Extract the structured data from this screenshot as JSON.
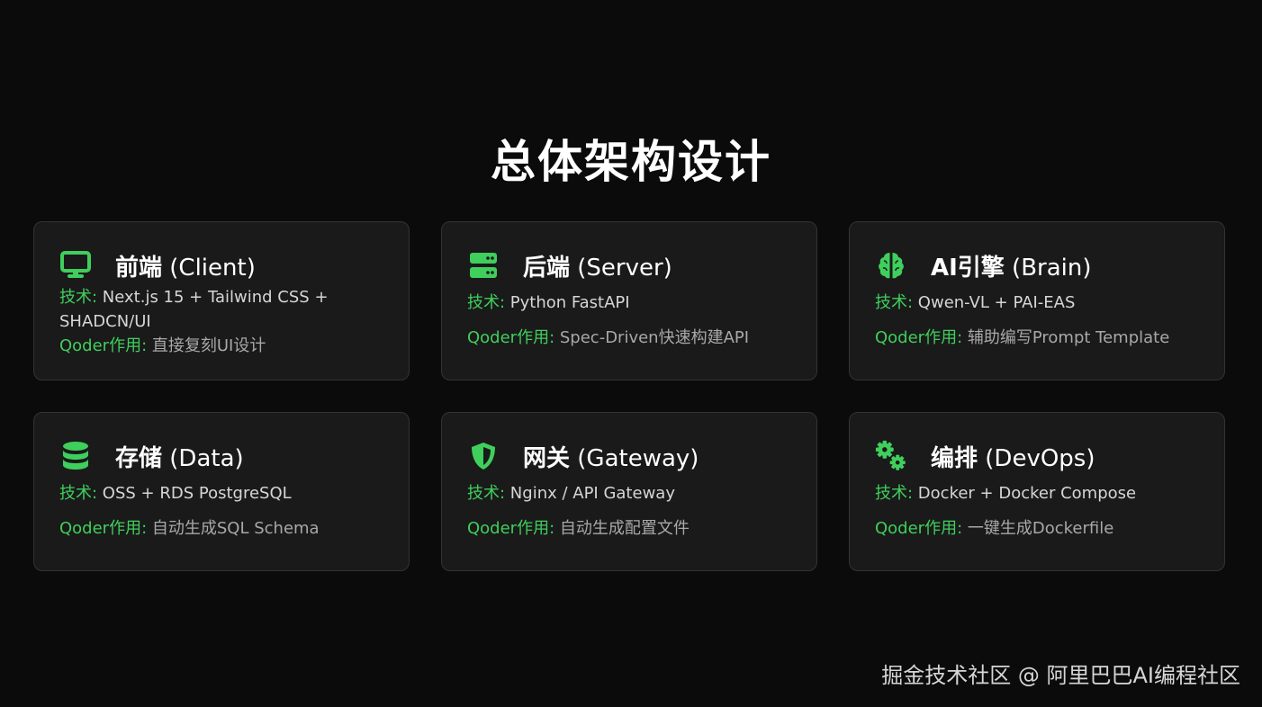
{
  "page": {
    "title": "总体架构设计",
    "footer": "掘金技术社区 @ 阿里巴巴AI编程社区"
  },
  "colors": {
    "background": "#0b0b0b",
    "card_bg": "#1a1a1a",
    "card_border": "#333333",
    "accent_green": "#3fcf5c",
    "text_primary": "#ffffff",
    "text_secondary": "#d6d6d6",
    "text_muted": "#a8a8a8"
  },
  "cards": [
    {
      "icon": "monitor-icon",
      "title": "前端",
      "title_en": " (Client)",
      "tech_key": "技术:",
      "tech_value": " Next.js 15 + Tailwind CSS + SHADCN/UI",
      "role_key": "Qoder作用:",
      "role_value": " 直接复刻UI设计"
    },
    {
      "icon": "server-icon",
      "title": "后端",
      "title_en": " (Server)",
      "tech_key": "技术:",
      "tech_value": " Python FastAPI",
      "role_key": "Qoder作用:",
      "role_value": " Spec-Driven快速构建API"
    },
    {
      "icon": "brain-icon",
      "title": "AI引擎",
      "title_en": " (Brain)",
      "tech_key": "技术:",
      "tech_value": " Qwen-VL + PAI-EAS",
      "role_key": "Qoder作用:",
      "role_value": " 辅助编写Prompt Template"
    },
    {
      "icon": "database-icon",
      "title": "存储",
      "title_en": " (Data)",
      "tech_key": "技术:",
      "tech_value": " OSS + RDS PostgreSQL",
      "role_key": "Qoder作用:",
      "role_value": " 自动生成SQL Schema"
    },
    {
      "icon": "shield-icon",
      "title": "网关",
      "title_en": " (Gateway)",
      "tech_key": "技术:",
      "tech_value": " Nginx / API Gateway",
      "role_key": "Qoder作用:",
      "role_value": " 自动生成配置文件"
    },
    {
      "icon": "gears-icon",
      "title": "编排",
      "title_en": " (DevOps)",
      "tech_key": "技术:",
      "tech_value": " Docker + Docker Compose",
      "role_key": "Qoder作用:",
      "role_value": " 一键生成Dockerfile"
    }
  ]
}
